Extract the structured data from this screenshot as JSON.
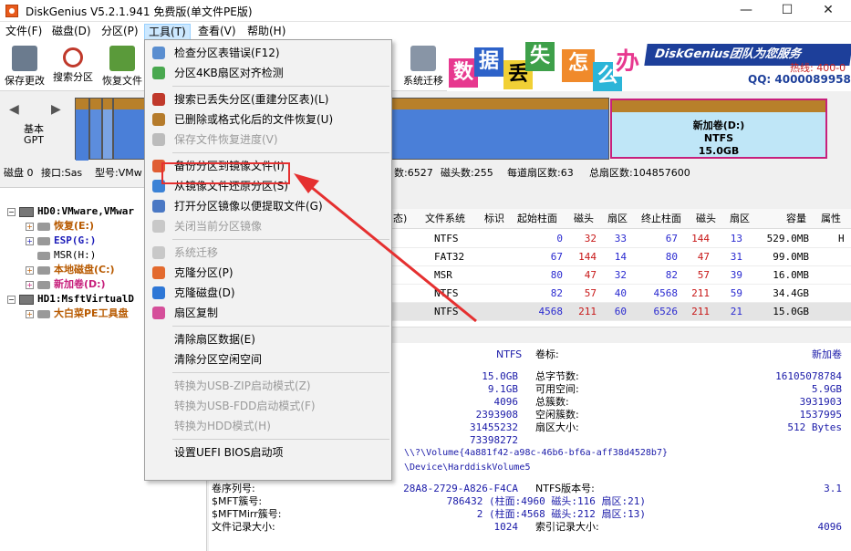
{
  "window": {
    "title": "DiskGenius V5.2.1.941 免费版(单文件PE版)",
    "min": "—",
    "max": "☐",
    "close": "✕"
  },
  "menubar": [
    "文件(F)",
    "磁盘(D)",
    "分区(P)",
    "工具(T)",
    "查看(V)",
    "帮助(H)"
  ],
  "toolbar": [
    {
      "label": "保存更改",
      "icon": "save-icon"
    },
    {
      "label": "搜索分区",
      "icon": "search-icon"
    },
    {
      "label": "恢复文件",
      "icon": "recover-icon"
    },
    {
      "label": "系统迁移",
      "icon": "migrate-icon"
    }
  ],
  "banner": {
    "chars": [
      "数",
      "据",
      "丢",
      "失",
      "怎",
      "么",
      "办"
    ],
    "brand": "DiskGenius团队为您服务",
    "qq": "QQ: 4000089958(",
    "tel": "热线: 400-0"
  },
  "diskbar": {
    "type": "基本",
    "style": "GPT",
    "partD": {
      "name": "新加卷(D:)",
      "fs": "NTFS",
      "size": "15.0GB"
    }
  },
  "diskinfo": {
    "disk": "磁盘 0",
    "iface": "接口:Sas",
    "model": "型号:VMw",
    "cyl": "数:6527",
    "heads": "磁头数:255",
    "spt": "每道扇区数:63",
    "total": "总扇区数:104857600"
  },
  "tree": {
    "hd0": "HD0:VMware,VMwar",
    "hd0_parts": [
      "恢复(E:)",
      "ESP(G:)",
      "MSR(H:)",
      "本地磁盘(C:)",
      "新加卷(D:)"
    ],
    "hd1": "HD1:MsftVirtualD",
    "hd1_parts": [
      "大白菜PE工具盘"
    ]
  },
  "table": {
    "headers": [
      "态)",
      "文件系统",
      "标识",
      "起始柱面",
      "磁头",
      "扇区",
      "终止柱面",
      "磁头",
      "扇区",
      "容量",
      "属性"
    ],
    "rows": [
      [
        "NTFS",
        "",
        "0",
        "32",
        "33",
        "67",
        "144",
        "13",
        "529.0MB",
        "H"
      ],
      [
        "FAT32",
        "",
        "67",
        "144",
        "14",
        "80",
        "47",
        "31",
        "99.0MB",
        ""
      ],
      [
        "MSR",
        "",
        "80",
        "47",
        "32",
        "82",
        "57",
        "39",
        "16.0MB",
        ""
      ],
      [
        "NTFS",
        "",
        "82",
        "57",
        "40",
        "4568",
        "211",
        "59",
        "34.4GB",
        ""
      ],
      [
        "NTFS",
        "",
        "4568",
        "211",
        "60",
        "6526",
        "211",
        "21",
        "15.0GB",
        ""
      ]
    ]
  },
  "detail": {
    "fs": "NTFS",
    "vol_label_k": "卷标:",
    "vol_label_v": "新加卷",
    "left_vals": [
      "15.0GB",
      "9.1GB",
      "4096",
      "2393908",
      "31455232",
      "73398272"
    ],
    "right_keys": [
      "总字节数:",
      "可用空间:",
      "总簇数:",
      "空闲簇数:",
      "扇区大小:"
    ],
    "right_vals": [
      "16105078784",
      "5.9GB",
      "3931903",
      "1537995",
      "512 Bytes"
    ],
    "guid": "\\\\?\\Volume{4a881f42-a98c-46b6-bf6a-aff38d4528b7}",
    "device": "\\Device\\HarddiskVolume5",
    "serial_k": "卷序列号:",
    "serial_v": "28A8-2729-A826-F4CA",
    "ntfsver_k": "NTFS版本号:",
    "ntfsver_v": "3.1",
    "mft_k": "$MFT簇号:",
    "mft_v": "786432 (柱面:4960 磁头:116 扇区:21)",
    "mftm_k": "$MFTMirr簇号:",
    "mftm_v": "2 (柱面:4568 磁头:212 扇区:13)",
    "rec_k": "文件记录大小:",
    "rec_v": "1024",
    "idx_k": "索引记录大小:",
    "idx_v": "4096"
  },
  "dropdown": [
    {
      "label": "检查分区表错误(F12)",
      "icon": "check-icon",
      "disabled": false
    },
    {
      "label": "分区4KB扇区对齐检测",
      "icon": "align-icon",
      "disabled": false
    },
    {
      "label": "搜索已丢失分区(重建分区表)(L)",
      "icon": "search-lost-icon",
      "disabled": false
    },
    {
      "label": "已删除或格式化后的文件恢复(U)",
      "icon": "recover-file-icon",
      "disabled": false
    },
    {
      "label": "保存文件恢复进度(V)",
      "icon": "save-progress-icon",
      "disabled": true
    },
    {
      "label": "备份分区到镜像文件(I)",
      "icon": "backup-icon",
      "disabled": false
    },
    {
      "label": "从镜像文件还原分区(S)",
      "icon": "restore-icon",
      "disabled": false
    },
    {
      "label": "打开分区镜像以便提取文件(G)",
      "icon": "open-image-icon",
      "disabled": false
    },
    {
      "label": "关闭当前分区镜像",
      "icon": "close-image-icon",
      "disabled": true
    },
    {
      "label": "系统迁移",
      "icon": "migrate-icon",
      "disabled": true
    },
    {
      "label": "克隆分区(P)",
      "icon": "clone-partition-icon",
      "disabled": false
    },
    {
      "label": "克隆磁盘(D)",
      "icon": "clone-disk-icon",
      "disabled": false
    },
    {
      "label": "扇区复制",
      "icon": "sector-copy-icon",
      "disabled": false
    },
    {
      "label": "清除扇区数据(E)",
      "icon": "erase-sector-icon",
      "disabled": false
    },
    {
      "label": "清除分区空闲空间",
      "icon": "erase-free-icon",
      "disabled": false
    },
    {
      "label": "转换为USB-ZIP启动模式(Z)",
      "icon": "usb-zip-icon",
      "disabled": true
    },
    {
      "label": "转换为USB-FDD启动模式(F)",
      "icon": "usb-fdd-icon",
      "disabled": true
    },
    {
      "label": "转换为HDD模式(H)",
      "icon": "hdd-mode-icon",
      "disabled": true
    },
    {
      "label": "设置UEFI BIOS启动项",
      "icon": "uefi-icon",
      "disabled": false
    }
  ],
  "colors": {
    "accent_red": "#e53030",
    "partition_blue": "#4a7fd8",
    "partition_brown": "#b8802a",
    "selected_magenta": "#c7207c"
  }
}
